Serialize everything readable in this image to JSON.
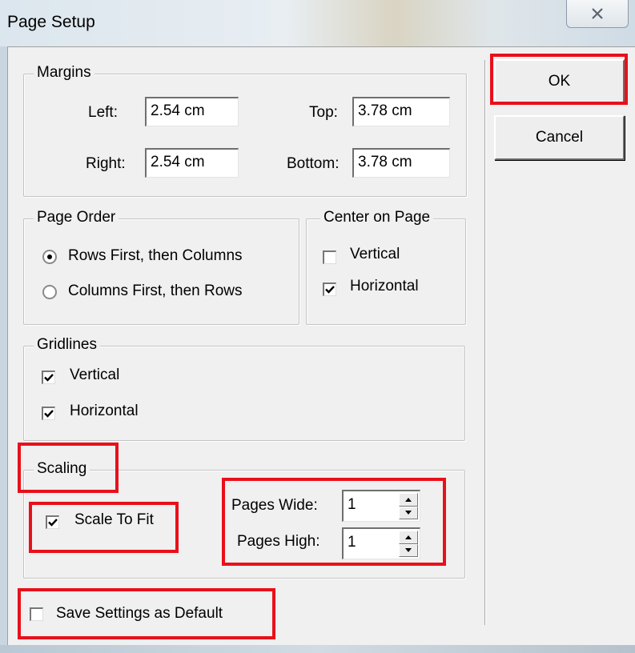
{
  "window": {
    "title": "Page Setup"
  },
  "buttons": {
    "ok": "OK",
    "cancel": "Cancel"
  },
  "margins": {
    "legend": "Margins",
    "left_label": "Left:",
    "left_value": "2.54 cm",
    "top_label": "Top:",
    "top_value": "3.78 cm",
    "right_label": "Right:",
    "right_value": "2.54 cm",
    "bottom_label": "Bottom:",
    "bottom_value": "3.78 cm"
  },
  "page_order": {
    "legend": "Page Order",
    "options": [
      {
        "label": "Rows First, then Columns",
        "selected": true
      },
      {
        "label": "Columns First, then Rows",
        "selected": false
      }
    ]
  },
  "center_on_page": {
    "legend": "Center on Page",
    "vertical": {
      "label": "Vertical",
      "checked": false
    },
    "horizontal": {
      "label": "Horizontal",
      "checked": true
    }
  },
  "gridlines": {
    "legend": "Gridlines",
    "vertical": {
      "label": "Vertical",
      "checked": true
    },
    "horizontal": {
      "label": "Horizontal",
      "checked": true
    }
  },
  "scaling": {
    "legend": "Scaling",
    "scale_to_fit": {
      "label": "Scale To Fit",
      "checked": true
    },
    "pages_wide_label": "Pages Wide:",
    "pages_wide_value": "1",
    "pages_high_label": "Pages High:",
    "pages_high_value": "1"
  },
  "save_default": {
    "label": "Save Settings as Default",
    "checked": false
  },
  "colors": {
    "highlight": "#e8101a",
    "dialog_face": "#f0f0f0"
  }
}
